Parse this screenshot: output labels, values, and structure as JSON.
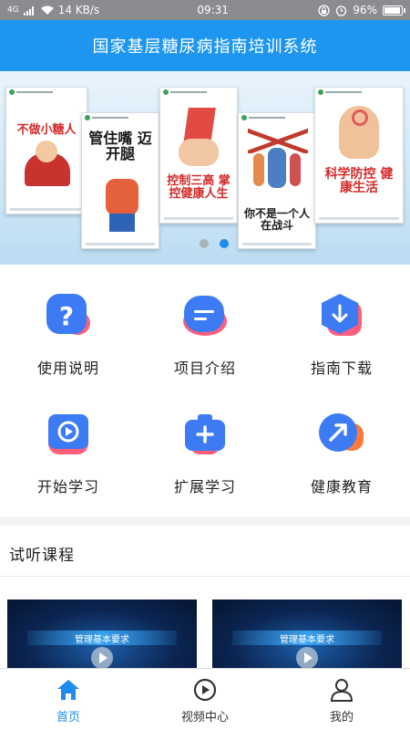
{
  "status_bar": {
    "network": "4G",
    "speed": "14 KB/s",
    "time": "09:31",
    "battery": "96%",
    "battery_level": 0.96
  },
  "header": {
    "title": "国家基层糖尿病指南培训系统"
  },
  "banner": {
    "posters": [
      {
        "text": "不做小糖人"
      },
      {
        "text": "管住嘴 迈开腿"
      },
      {
        "text": "控制三高 掌控健康人生"
      },
      {
        "text": "你不是一个人 在战斗"
      },
      {
        "text": "科学防控 健康生活"
      }
    ],
    "page_count": 2,
    "active_page": 2
  },
  "menu": {
    "items": [
      {
        "label": "使用说明",
        "icon": "question-icon",
        "color": "#3d7bf5"
      },
      {
        "label": "项目介绍",
        "icon": "list-icon",
        "color": "#3d7bf5"
      },
      {
        "label": "指南下载",
        "icon": "download-icon",
        "color": "#3d7bf5"
      },
      {
        "label": "开始学习",
        "icon": "play-icon",
        "color": "#3d7bf5"
      },
      {
        "label": "扩展学习",
        "icon": "plus-bag-icon",
        "color": "#3d7bf5"
      },
      {
        "label": "健康教育",
        "icon": "arrow-up-right-icon",
        "color": "#3d7bf5"
      }
    ]
  },
  "courses": {
    "title": "试听课程",
    "items": [
      {
        "label": "管理基本要求"
      },
      {
        "label": "管理基本要求"
      }
    ]
  },
  "bottom_nav": {
    "items": [
      {
        "label": "首页",
        "icon": "home-icon",
        "active": true
      },
      {
        "label": "视频中心",
        "icon": "video-icon",
        "active": false
      },
      {
        "label": "我的",
        "icon": "user-icon",
        "active": false
      }
    ]
  },
  "colors": {
    "primary": "#1e96f0",
    "accent": "#3d7bf5",
    "secondary": "#ff5e7a"
  }
}
